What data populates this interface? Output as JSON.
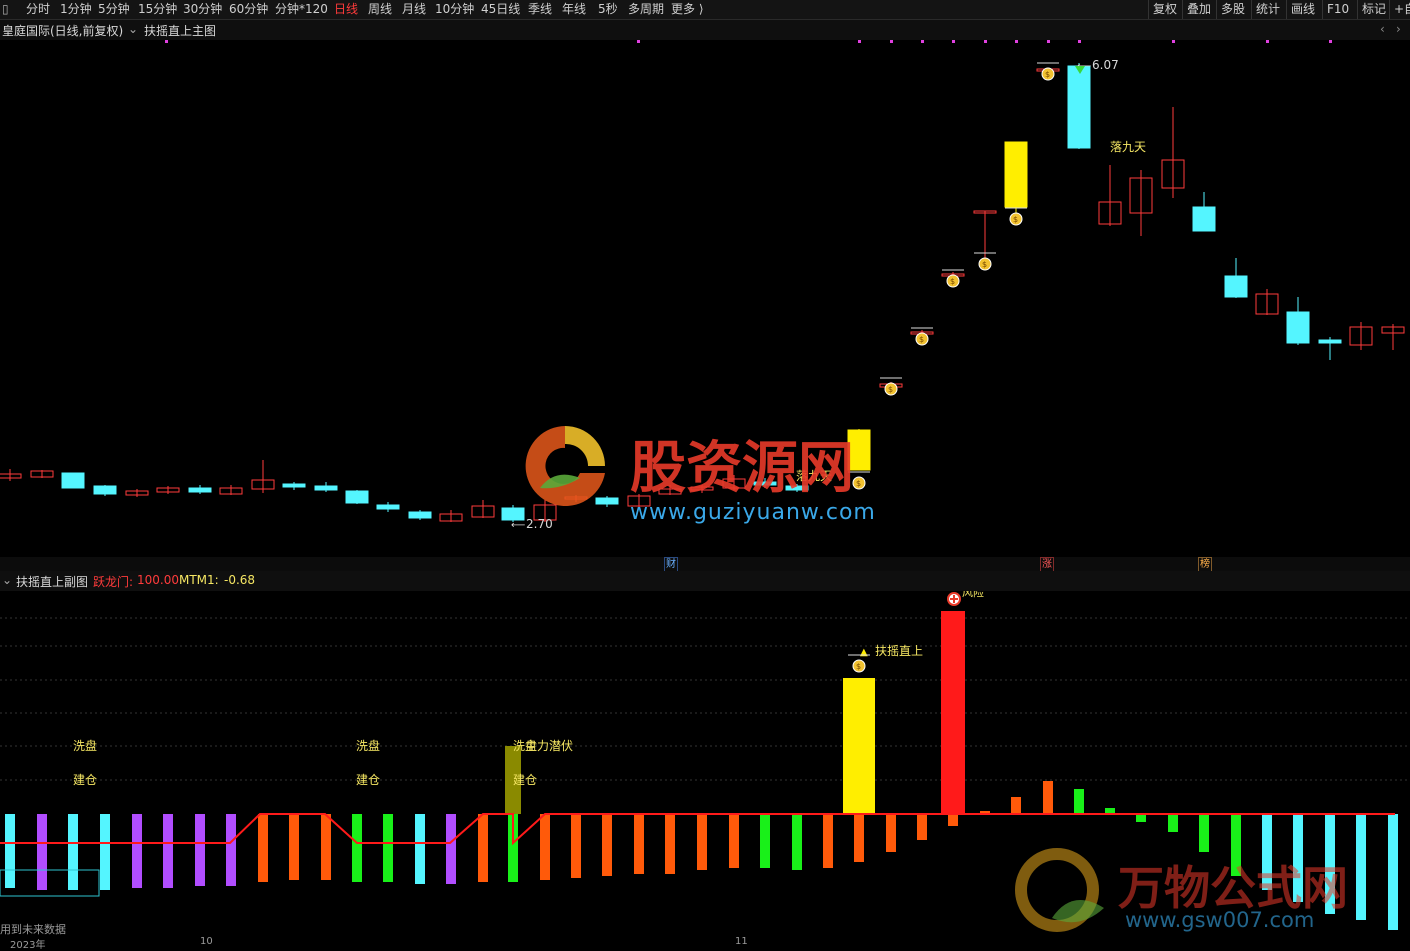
{
  "toolbar": {
    "periods": [
      "分时",
      "1分钟",
      "5分钟",
      "15分钟",
      "30分钟",
      "60分钟",
      "分钟*120",
      "日线",
      "周线",
      "月线",
      "10分钟",
      "45日线",
      "季线",
      "年线",
      "5秒",
      "多周期",
      "更多 ⟩"
    ],
    "active_period": "日线",
    "right_buttons": [
      "复权",
      "叠加",
      "多股",
      "统计",
      "画线",
      "F10",
      "标记",
      "+自"
    ]
  },
  "main_header": {
    "stock": "皇庭国际(日线,前复权)",
    "indicator": "扶摇直上主图"
  },
  "main_chart": {
    "annotations": {
      "high": "6.07",
      "low": "2.70",
      "luojiutian": "落九天"
    },
    "event_markers": [
      "财",
      "涨",
      "榜"
    ]
  },
  "sub_header": {
    "indicator": "扶摇直上副图",
    "metric1_label": "跃龙门:",
    "metric1_value": "100.00",
    "metric2_label": "MTM1:",
    "metric2_value": "-0.68"
  },
  "sub_chart": {
    "labels": {
      "xipan": "洗盘",
      "jiancang": "建仓",
      "zhulichuifu": "主力潜伏",
      "fuyao": "扶摇直上",
      "cut_top": "风险"
    }
  },
  "footer": {
    "note": "用到未来数据",
    "axis_labels": [
      "2023年",
      "10",
      "11"
    ]
  },
  "watermarks": {
    "w1_cn": "股资源网",
    "w1_url": "www.guziyuanw.com",
    "w2_cn": "万物公式网",
    "w2_url": "www.gsw007.com"
  },
  "colors": {
    "up": "#ff3b3b",
    "down": "#54f5ff",
    "active": "#ff3b3b"
  }
}
